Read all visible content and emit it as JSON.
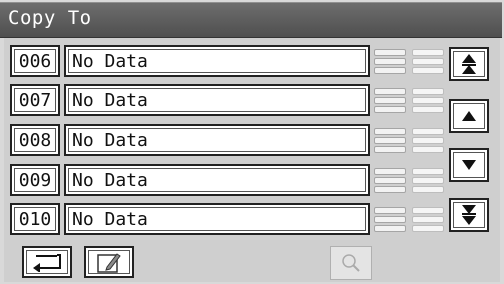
{
  "window": {
    "title": "Copy To"
  },
  "rows": [
    {
      "number": "006",
      "name": "No Data"
    },
    {
      "number": "007",
      "name": "No Data"
    },
    {
      "number": "008",
      "name": "No Data"
    },
    {
      "number": "009",
      "name": "No Data"
    },
    {
      "number": "010",
      "name": "No Data"
    }
  ],
  "icons": {
    "scroll_top": "double-up-arrow-icon",
    "scroll_up": "up-arrow-icon",
    "scroll_down": "down-arrow-icon",
    "scroll_bottom": "double-down-arrow-icon",
    "back": "return-arrow-icon",
    "edit": "edit-pencil-icon",
    "search": "magnifier-icon",
    "bars": "list-lines-icon"
  }
}
